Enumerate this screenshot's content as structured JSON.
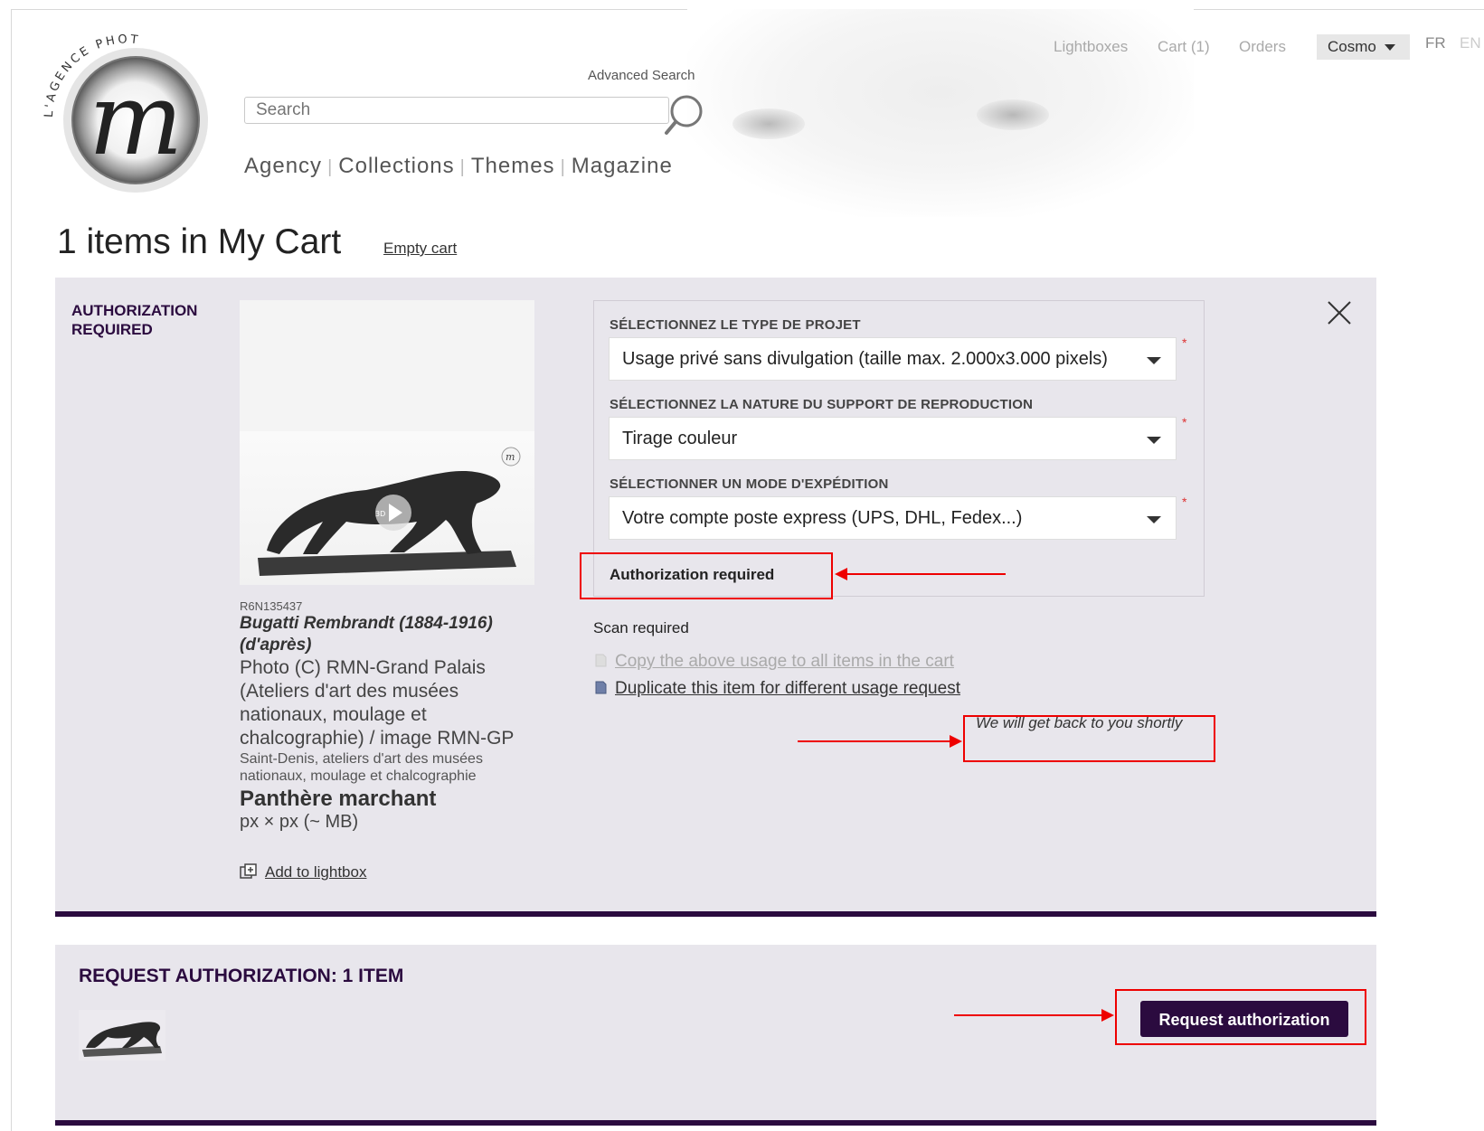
{
  "header": {
    "search_placeholder": "Search",
    "advanced_search": "Advanced Search",
    "nav": [
      "Agency",
      "Collections",
      "Themes",
      "Magazine"
    ],
    "top_links": [
      "Lightboxes",
      "Cart (1)",
      "Orders"
    ],
    "user_menu": "Cosmo",
    "lang": [
      "FR",
      "EN"
    ],
    "logo_text": "L'AGENCE PHOTO"
  },
  "page": {
    "title": "1 items in My Cart",
    "empty_cart": "Empty cart"
  },
  "cart_item": {
    "status_label": "AUTHORIZATION REQUIRED",
    "ref": "R6N135437",
    "artist": "Bugatti Rembrandt (1884-1916) (d'après)",
    "credit": "Photo (C) RMN-Grand Palais (Ateliers d'art des musées nationaux, moulage et chalcographie) / image RMN-GP",
    "location": "Saint-Denis, ateliers d'art des musées nationaux, moulage et chalcographie",
    "title": "Panthère marchant",
    "size": "px × px (~ MB)",
    "add_lightbox": "Add to lightbox",
    "form": {
      "project_type_label": "SÉLECTIONNEZ LE TYPE DE PROJET",
      "project_type_value": "Usage privé sans divulgation (taille max. 2.000x3.000 pixels)",
      "support_label": "SÉLECTIONNEZ LA NATURE DU SUPPORT DE REPRODUCTION",
      "support_value": "Tirage couleur",
      "shipping_label": "SÉLECTIONNER UN MODE D'EXPÉDITION",
      "shipping_value": "Votre compte poste express (UPS, DHL, Fedex...)",
      "required_marker": "*",
      "auth_required": "Authorization required"
    },
    "scan_required": "Scan required",
    "copy_usage": "Copy the above usage to all items in the cart",
    "duplicate_item": "Duplicate this item for different usage request",
    "shortly_note": "We will get back to you shortly"
  },
  "request_panel": {
    "title": "REQUEST AUTHORIZATION: 1 ITEM",
    "button": "Request authorization"
  },
  "colors": {
    "brand_dark": "#2b0b3f",
    "panel_bg": "#e8e6ec",
    "annotation_red": "#e00000"
  }
}
